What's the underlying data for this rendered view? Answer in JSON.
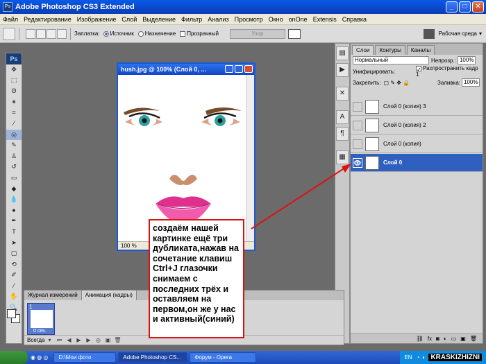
{
  "window": {
    "title": "Adobe Photoshop CS3 Extended"
  },
  "menu": [
    "Файл",
    "Редактирование",
    "Изображение",
    "Слой",
    "Выделение",
    "Фильтр",
    "Анализ",
    "Просмотр",
    "Окно",
    "onOne",
    "Extensis",
    "Справка"
  ],
  "options": {
    "patch_label": "Заплатка:",
    "source_label": "Источник",
    "dest_label": "Назначение",
    "transparent_label": "Прозрачный",
    "pattern_btn": "Узор",
    "workspace_label": "Рабочая среда"
  },
  "document": {
    "title": "hush.jpg @ 100% (Слой 0, ...",
    "zoom": "100 %"
  },
  "annotation": {
    "text": "создаём нашей картинке ещё три дубликата,нажав на сочетание клавиш  Ctrl+J глазочки снимаем с последних трёх и оставляем на первом,он же у нас и активный(синий)"
  },
  "animation": {
    "tabs": [
      "Журнал измерений",
      "Анимация (кадры)"
    ],
    "frame_number": "1",
    "frame_delay": "0 сек.",
    "loop": "Всегда"
  },
  "layers_panel": {
    "tabs": [
      "Слои",
      "Контуры",
      "Каналы"
    ],
    "blend_mode": "Нормальный",
    "opacity_label": "Непрозр.:",
    "opacity_value": "100%",
    "unify_label": "Унифицировать:",
    "propagate_label": "Распространить кадр 1",
    "lock_label": "Закрепить:",
    "fill_label": "Заливка:",
    "fill_value": "100%",
    "layers": [
      {
        "name": "Слой 0 (копия) 3",
        "visible": false,
        "active": false
      },
      {
        "name": "Слой 0 (копия) 2",
        "visible": false,
        "active": false
      },
      {
        "name": "Слой 0 (копия)",
        "visible": false,
        "active": false
      },
      {
        "name": "Слой 0",
        "visible": true,
        "active": true
      }
    ]
  },
  "taskbar": {
    "items": [
      "D:\\Мои фото",
      "Adobe Photoshop CS...",
      "Форум - Opera"
    ],
    "lang": "EN",
    "brand": "KRASKIZHIZNI"
  },
  "colors": {
    "active_layer": "#2f5fbf",
    "annotation_border": "#dd1111",
    "arrow": "#dd1111"
  }
}
